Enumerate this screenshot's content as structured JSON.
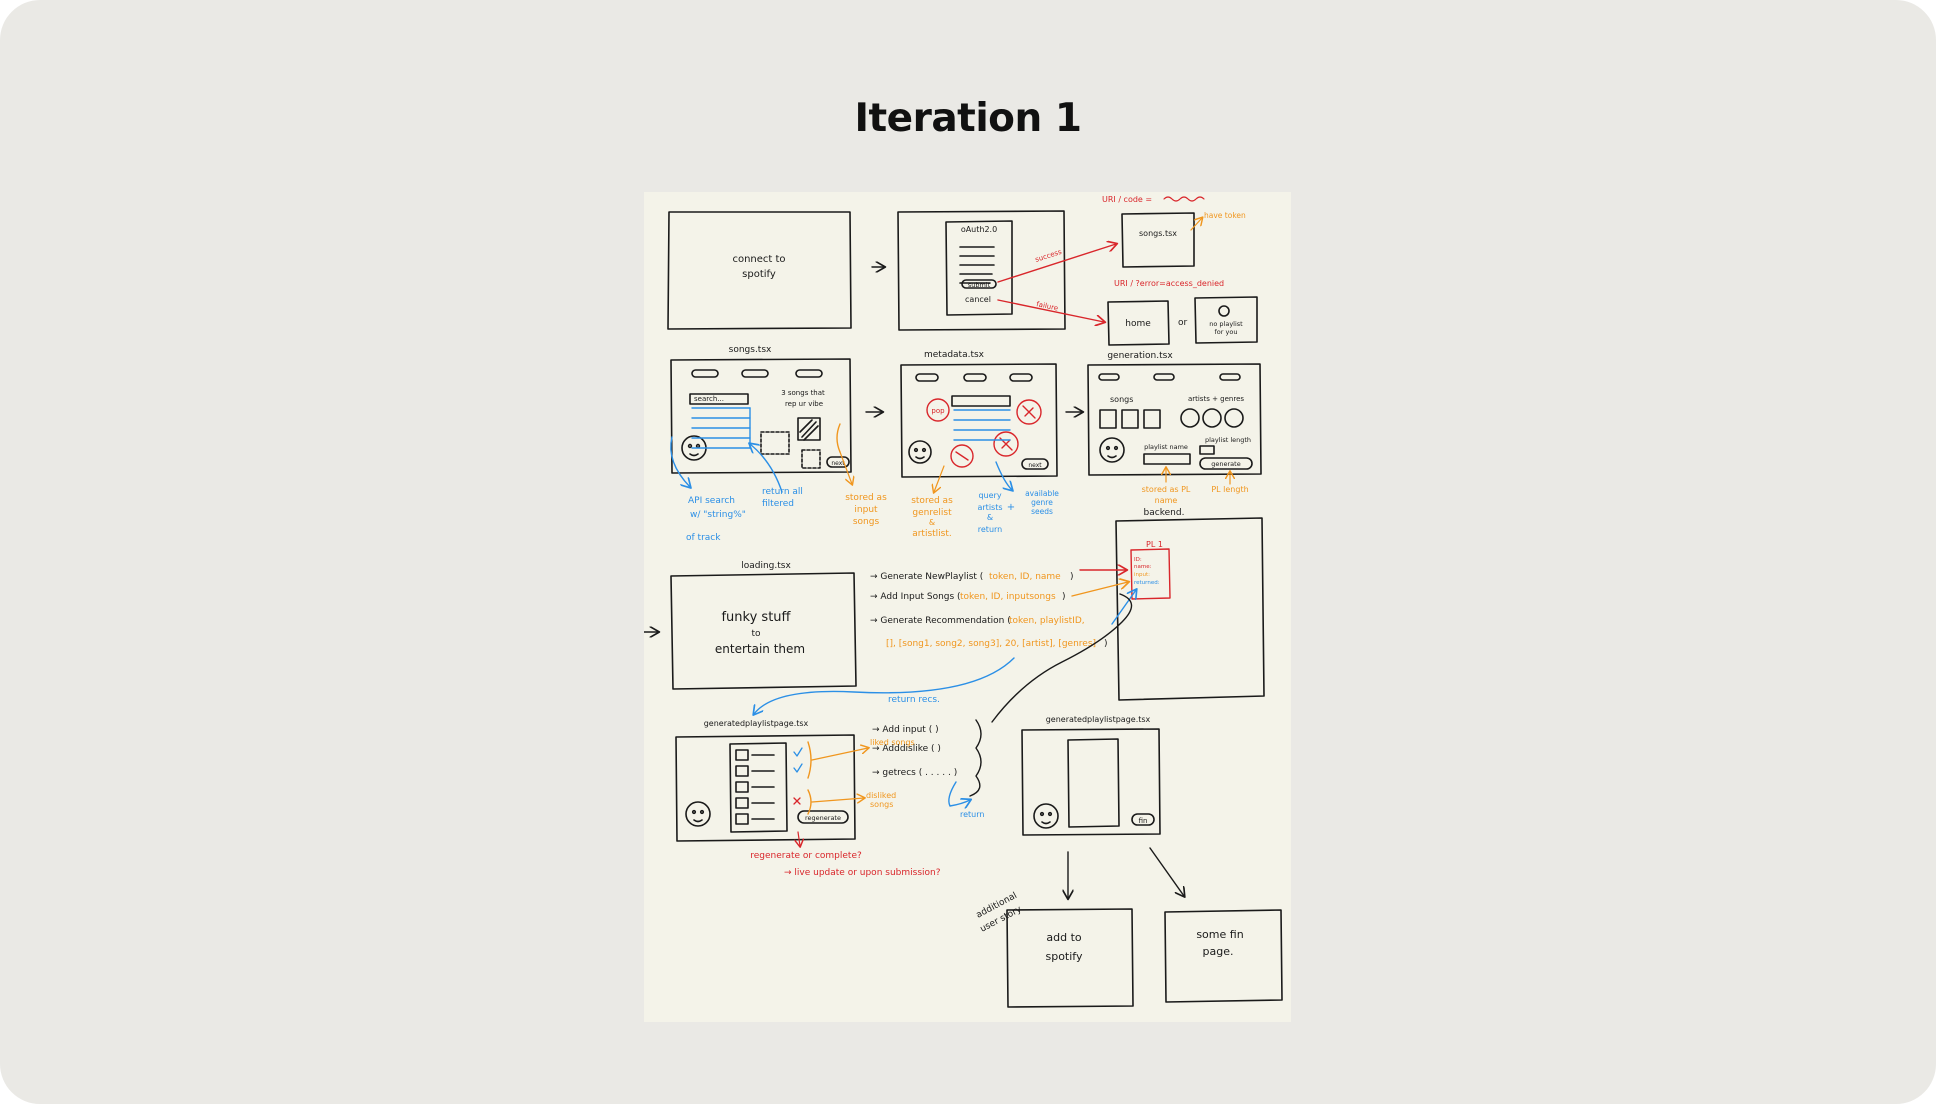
{
  "slide": {
    "title": "Iteration 1"
  },
  "colors": {
    "ink": "#1a1a1a",
    "red": "#d9262b",
    "orange": "#f0961e",
    "blue": "#2b8fe6",
    "paper": "#f4f3e9",
    "background": "#eae9e5"
  },
  "sketch": {
    "connect": {
      "line1": "connect to",
      "line2": "spotify"
    },
    "oauth": {
      "title": "oAuth2.0",
      "submit": "submit",
      "cancel": "cancel",
      "success": "success",
      "failure": "failure"
    },
    "uri_code": "URI / code =",
    "songs_tsx_top": "songs.tsx",
    "have_token": "have token",
    "uri_error": "URI / ?error=access_denied",
    "home": "home",
    "or": "or",
    "no_playlist": {
      "line1": "no playlist",
      "line2": "for you"
    },
    "songs_tsx": "songs.tsx",
    "songs_screen": {
      "search": "search...",
      "hint1": "3 songs that",
      "hint2": "rep ur vibe",
      "next": "next"
    },
    "songs_notes": {
      "api1": "API search",
      "api2": "w/ \"string%\"",
      "api3": "of track",
      "return1": "return all",
      "return2": "filtered",
      "stored1": "stored as",
      "stored2": "input",
      "stored3": "songs"
    },
    "metadata_tsx": "metadata.tsx",
    "metadata_screen": {
      "pop": "pop",
      "next": "next"
    },
    "metadata_notes": {
      "stored1": "stored as",
      "stored2": "genrelist",
      "stored3": "&",
      "stored4": "artistlist.",
      "query1": "query",
      "query2": "artists",
      "query3": "&",
      "query4": "return",
      "plus": "+",
      "avail1": "available",
      "avail2": "genre",
      "avail3": "seeds"
    },
    "generation_tsx": "generation.tsx",
    "generation_screen": {
      "songs": "songs",
      "artists": "artists + genres",
      "plname": "playlist name",
      "pllength": "playlist length",
      "generate": "generate"
    },
    "generation_notes": {
      "stored1": "stored as PL",
      "stored2": "name",
      "pllength": "PL length"
    },
    "backend": "backend.",
    "pl1": {
      "title": "PL 1",
      "id": "ID:",
      "name": "name:",
      "input": "input:",
      "returned": "returned:"
    },
    "loading_tsx": "loading.tsx",
    "loading_screen": {
      "line1": "funky stuff",
      "line2": "to",
      "line3": "entertain them"
    },
    "functions": {
      "f1": "→ Generate NewPlaylist (",
      "f1args": "token, ID, name",
      "f2": "→ Add Input Songs (",
      "f2args": "token, ID, inputsongs",
      "f3": "→ Generate Recommendation (",
      "f3args": "token, playlistID,",
      "f3line2": "[], [song1, song2, song3], 20, [artist], [genres]",
      "close": ")"
    },
    "return_recs": "return recs.",
    "generated_tsx": "generatedplaylistpage.tsx",
    "generated_screen": {
      "regenerate": "regenerate"
    },
    "liked": "liked songs",
    "disliked1": "disliked",
    "disliked2": "songs",
    "calls": {
      "c1": "→ Add input ( )",
      "c2": "→ Adddislike ( )",
      "c3": "→ getrecs ( . . . . . )"
    },
    "return": "return",
    "questions": {
      "q1": "regenerate or complete?",
      "q2": "→ live update or upon submission?"
    },
    "generated_tsx2": "generatedplaylistpage.tsx",
    "fin": "fin",
    "additional1": "additional",
    "additional2": "user story",
    "add_spotify": {
      "line1": "add to",
      "line2": "spotify"
    },
    "some_fin": {
      "line1": "some fin",
      "line2": "page."
    }
  }
}
